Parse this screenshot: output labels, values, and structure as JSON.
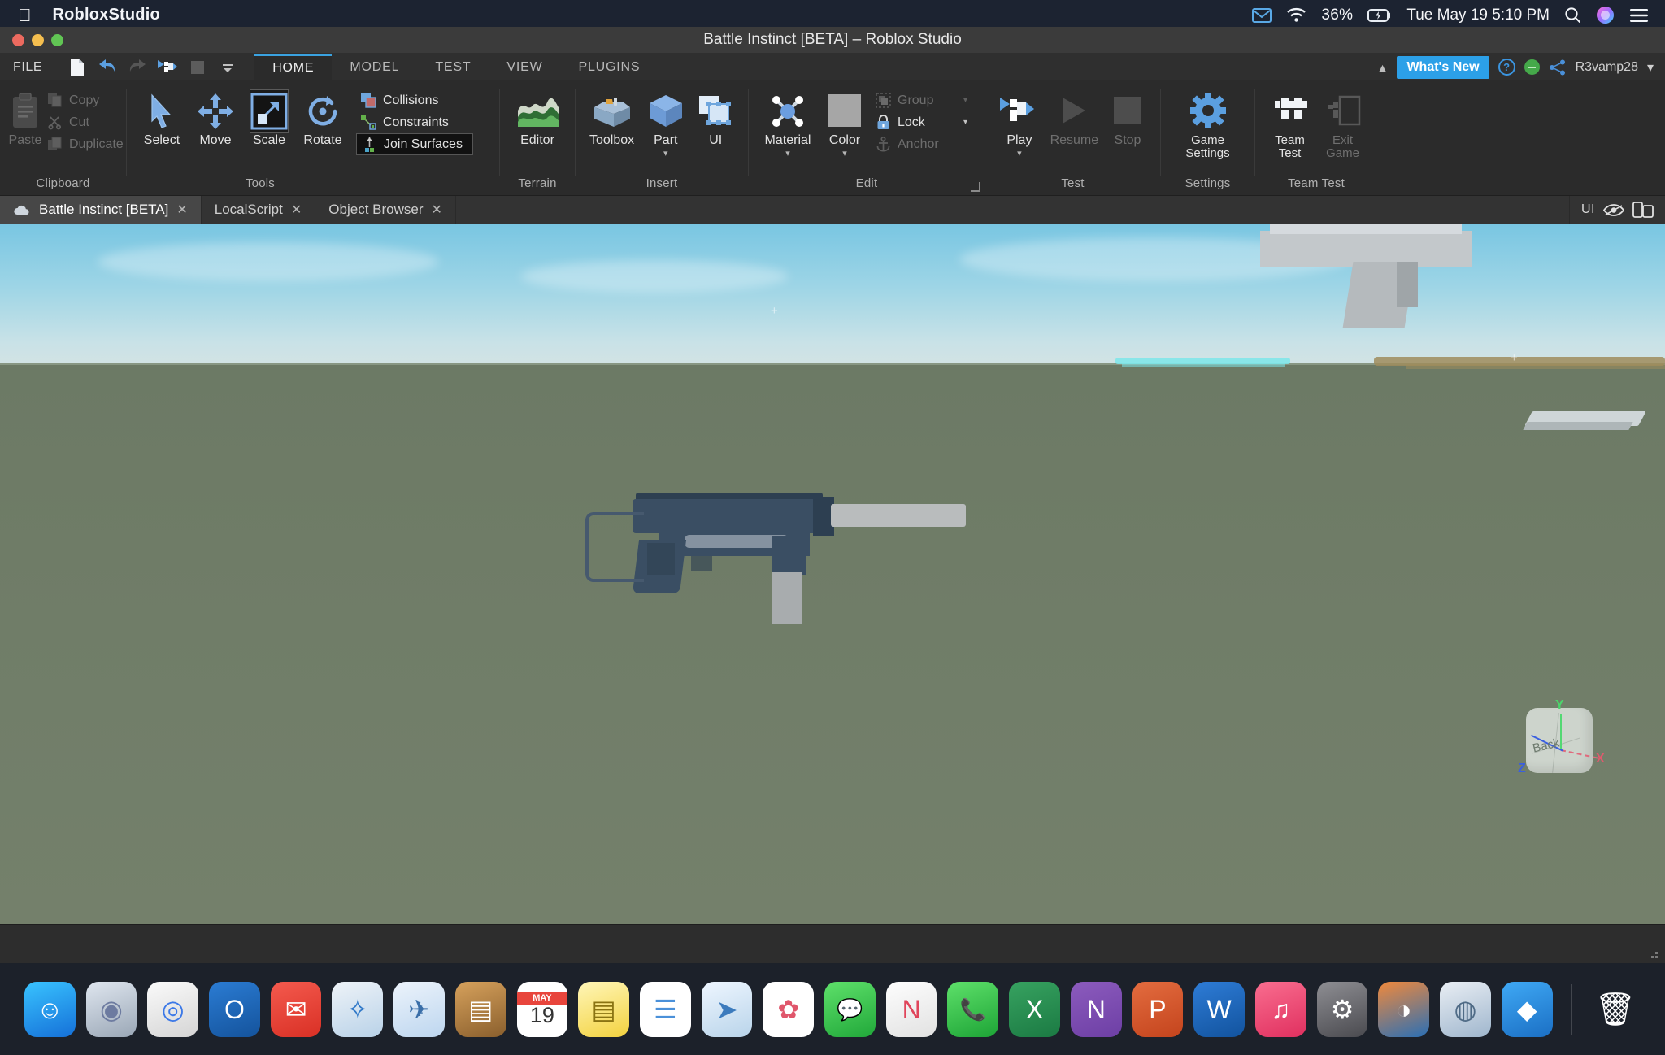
{
  "macbar": {
    "apple_icon": "apple-logo",
    "app_name": "RobloxStudio",
    "mail_icon": "mail-icon",
    "wifi_icon": "wifi-icon",
    "battery_percent": "36%",
    "battery_icon": "battery-charging-icon",
    "datetime": "Tue May 19  5:10 PM",
    "search_icon": "spotlight-search-icon",
    "siri_icon": "siri-icon",
    "controlcenter_icon": "notification-center-icon"
  },
  "window": {
    "title": "Battle Instinct [BETA] – Roblox Studio",
    "close_label": "close",
    "minimize_label": "minimize",
    "zoom_label": "zoom"
  },
  "quick_access": {
    "file_label": "FILE",
    "icons": [
      "new-document-icon",
      "undo-icon",
      "redo-icon",
      "play-solo-icon",
      "stop-square-icon",
      "overflow-icon"
    ]
  },
  "ribbon_tabs": [
    {
      "label": "HOME",
      "active": true
    },
    {
      "label": "MODEL",
      "active": false
    },
    {
      "label": "TEST",
      "active": false
    },
    {
      "label": "VIEW",
      "active": false
    },
    {
      "label": "PLUGINS",
      "active": false
    }
  ],
  "account_area": {
    "collapse_icon": "chevron-up-icon",
    "whats_new": "What's New",
    "help_icon": "help-question-icon",
    "status_icon": "presence-status-icon",
    "share_icon": "share-icon",
    "username": "R3vamp28",
    "username_caret": "▾"
  },
  "ribbon_groups": [
    {
      "name": "clipboard",
      "label": "Clipboard",
      "big": [
        {
          "label": "Paste",
          "icon": "paste-icon",
          "disabled": true
        }
      ],
      "small": [
        {
          "label": "Copy",
          "icon": "copy-icon",
          "disabled": true
        },
        {
          "label": "Cut",
          "icon": "cut-scissors-icon",
          "disabled": true
        },
        {
          "label": "Duplicate",
          "icon": "duplicate-icon",
          "disabled": true
        }
      ]
    },
    {
      "name": "tools",
      "label": "Tools",
      "big": [
        {
          "label": "Select",
          "icon": "cursor-arrow-icon",
          "selected": false
        },
        {
          "label": "Move",
          "icon": "move-arrows-icon",
          "selected": false
        },
        {
          "label": "Scale",
          "icon": "scale-icon",
          "selected": true
        },
        {
          "label": "Rotate",
          "icon": "rotate-icon",
          "selected": false
        }
      ],
      "small": [
        {
          "label": "Collisions",
          "icon": "collisions-icon",
          "disabled": false
        },
        {
          "label": "Constraints",
          "icon": "constraints-icon",
          "disabled": false
        },
        {
          "label": "Join Surfaces",
          "icon": "join-surfaces-icon",
          "disabled": false,
          "boxed": true
        }
      ]
    },
    {
      "name": "terrain",
      "label": "Terrain",
      "big": [
        {
          "label": "Editor",
          "icon": "terrain-editor-icon"
        }
      ]
    },
    {
      "name": "insert",
      "label": "Insert",
      "big": [
        {
          "label": "Toolbox",
          "icon": "toolbox-icon"
        },
        {
          "label": "Part",
          "icon": "part-cube-icon",
          "caret": "▾"
        },
        {
          "label": "UI",
          "icon": "ui-frame-icon"
        }
      ]
    },
    {
      "name": "edit",
      "label": "Edit",
      "big": [
        {
          "label": "Material",
          "icon": "material-icon",
          "caret": "▾"
        },
        {
          "label": "Color",
          "icon": "color-swatch-icon",
          "caret": "▾"
        }
      ],
      "small": [
        {
          "label": "Group",
          "icon": "group-icon",
          "disabled": true,
          "caret": "▾"
        },
        {
          "label": "Lock",
          "icon": "lock-icon",
          "disabled": false,
          "caret": "▾"
        },
        {
          "label": "Anchor",
          "icon": "anchor-icon",
          "disabled": true
        }
      ]
    },
    {
      "name": "test",
      "label": "Test",
      "big": [
        {
          "label": "Play",
          "icon": "play-avatar-icon",
          "caret": "▾"
        },
        {
          "label": "Resume",
          "icon": "resume-triangle-icon",
          "disabled": true
        },
        {
          "label": "Stop",
          "icon": "stop-square-icon",
          "disabled": true
        }
      ]
    },
    {
      "name": "settings",
      "label": "Settings",
      "big": [
        {
          "label": "Game Settings",
          "icon": "gear-icon"
        }
      ]
    },
    {
      "name": "team-test",
      "label": "Team Test",
      "big": [
        {
          "label": "Team Test",
          "icon": "team-test-icon"
        },
        {
          "label": "Exit Game",
          "icon": "exit-game-icon",
          "disabled": true
        }
      ]
    }
  ],
  "doc_tabs": [
    {
      "label": "Battle Instinct [BETA]",
      "icon": "cloud-icon",
      "active": true,
      "close": "✕"
    },
    {
      "label": "LocalScript",
      "icon": "",
      "active": false,
      "close": "✕"
    },
    {
      "label": "Object Browser",
      "icon": "",
      "active": false,
      "close": "✕"
    }
  ],
  "doc_tabs_right": {
    "ui_label": "UI",
    "eye_icon": "eye-visibility-icon",
    "device_icon": "device-emulation-icon"
  },
  "viewport": {
    "navcube": {
      "face_label": "Back",
      "axis_x": "X",
      "axis_y": "Y",
      "axis_z": "Z",
      "axis_x_color": "#e05a6e",
      "axis_y_color": "#4ad66b",
      "axis_z_color": "#3a5fe0"
    },
    "sky_color": "#9ed5e6",
    "ground_color": "#707d69",
    "selected_model": "submachine-gun-model"
  },
  "dock": {
    "apps": [
      {
        "name": "finder",
        "glyph": "☺",
        "bg": "linear-gradient(160deg,#39c3ff,#1570d8)",
        "running": true
      },
      {
        "name": "launchpad",
        "glyph": "◉",
        "bg": "linear-gradient(160deg,#dfe6ef,#9aa7b6)",
        "running": false
      },
      {
        "name": "google-chrome",
        "glyph": "◎",
        "bg": "linear-gradient(160deg,#f7f7f7,#d9d9d9)",
        "running": false
      },
      {
        "name": "outlook",
        "glyph": "O",
        "bg": "linear-gradient(160deg,#2b7cd3,#14539c)",
        "running": false
      },
      {
        "name": "gmail",
        "glyph": "✉",
        "bg": "linear-gradient(160deg,#f45a4e,#d93025)",
        "running": false
      },
      {
        "name": "safari",
        "glyph": "✧",
        "bg": "linear-gradient(160deg,#eef3f8,#bfd3e6)",
        "running": false
      },
      {
        "name": "mail",
        "glyph": "✈",
        "bg": "linear-gradient(160deg,#ecf3fb,#bdd6ef)",
        "running": false
      },
      {
        "name": "contacts",
        "glyph": "▤",
        "bg": "linear-gradient(160deg,#d6a15c,#8a5f2d)",
        "running": false
      },
      {
        "name": "calendar",
        "glyph": "19",
        "bg": "#ffffff",
        "running": false
      },
      {
        "name": "notes",
        "glyph": "▤",
        "bg": "linear-gradient(160deg,#fff3b0,#f5d547)",
        "running": false
      },
      {
        "name": "reminders",
        "glyph": "☰",
        "bg": "#ffffff",
        "running": false
      },
      {
        "name": "maps",
        "glyph": "➤",
        "bg": "linear-gradient(160deg,#eef6ff,#bcd8ef)",
        "running": false
      },
      {
        "name": "photos",
        "glyph": "✿",
        "bg": "#ffffff",
        "running": false
      },
      {
        "name": "messages",
        "glyph": "💬",
        "bg": "linear-gradient(160deg,#5ee06a,#21a83a)",
        "running": false
      },
      {
        "name": "news",
        "glyph": "N",
        "bg": "linear-gradient(160deg,#fdfdfd,#e2e2e2)",
        "running": false
      },
      {
        "name": "facetime",
        "glyph": "📞",
        "bg": "linear-gradient(160deg,#5ee06a,#1da436)",
        "running": false
      },
      {
        "name": "excel",
        "glyph": "X",
        "bg": "linear-gradient(160deg,#37a260,#1b7a43)",
        "running": false
      },
      {
        "name": "onenote",
        "glyph": "N",
        "bg": "linear-gradient(160deg,#8c5bbd,#6d3fa5)",
        "running": false
      },
      {
        "name": "powerpoint",
        "glyph": "P",
        "bg": "linear-gradient(160deg,#e36c3f,#c4441d)",
        "running": false
      },
      {
        "name": "word",
        "glyph": "W",
        "bg": "linear-gradient(160deg,#2e7cd6,#12539e)",
        "running": false
      },
      {
        "name": "itunes",
        "glyph": "♫",
        "bg": "linear-gradient(160deg,#f96d8f,#e0305f)",
        "running": false
      },
      {
        "name": "system-preferences",
        "glyph": "⚙",
        "bg": "linear-gradient(160deg,#8e8e93,#4a4a4f)",
        "running": false
      },
      {
        "name": "blender",
        "glyph": "◑",
        "bg": "linear-gradient(160deg,#f0893c,#2a6fb5)",
        "running": false
      },
      {
        "name": "roblox-studio",
        "glyph": "◍",
        "bg": "linear-gradient(160deg,#e9eef4,#9fb6cd)",
        "running": true
      },
      {
        "name": "roblox-player",
        "glyph": "◆",
        "bg": "linear-gradient(160deg,#3fa9f5,#1b6fc4)",
        "running": false
      }
    ],
    "trash": {
      "name": "trash",
      "glyph": "🗑"
    }
  }
}
